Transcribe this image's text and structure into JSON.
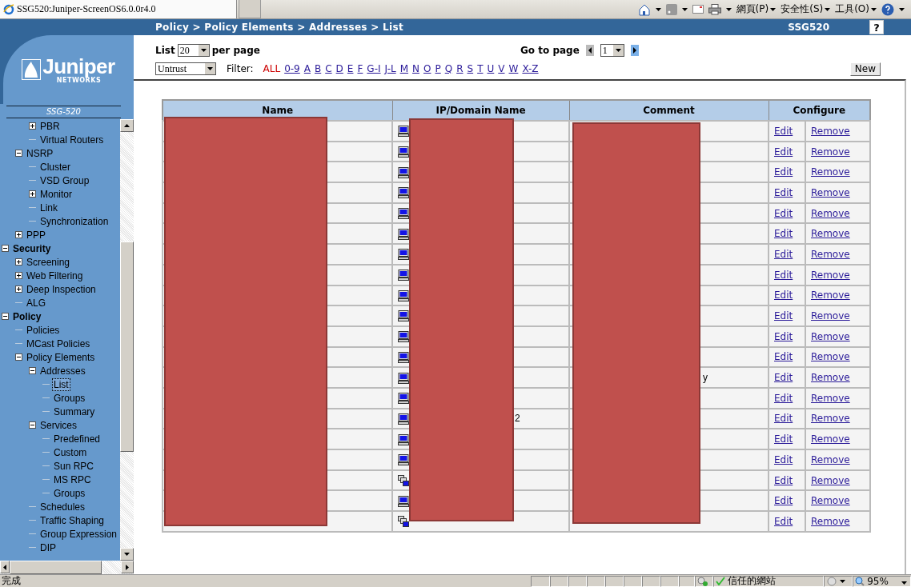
{
  "browser": {
    "tab_title": "SSG520:Juniper-ScreenOS6.0.0r4.0",
    "menus": [
      "網頁(P)",
      "安全性(S)",
      "工具(O)"
    ]
  },
  "header": {
    "breadcrumb": "Policy > Policy Elements > Addresses > List",
    "device": "SSG520",
    "help": "?"
  },
  "sidebar": {
    "logo": "Juniper",
    "logo_sub": "NETWORKS",
    "model": "SSG-520",
    "tree": [
      {
        "children": [
          {
            "children": [
              {
                "label": "PBR",
                "expanded": false,
                "selected": false
              },
              {
                "label": "Virtual Routers",
                "selected": false
              }
            ]
          },
          {
            "label": "NSRP",
            "expanded": true,
            "selected": false,
            "children": [
              {
                "label": "Cluster",
                "selected": false
              },
              {
                "label": "VSD Group",
                "selected": false
              },
              {
                "label": "Monitor",
                "expanded": false,
                "selected": false
              },
              {
                "label": "Link",
                "selected": false
              },
              {
                "label": "Synchronization",
                "selected": false
              }
            ]
          },
          {
            "label": "PPP",
            "expanded": false,
            "selected": false
          }
        ]
      },
      {
        "label": "Security",
        "expanded": true,
        "selected": false,
        "children": [
          {
            "label": "Screening",
            "expanded": false,
            "selected": false
          },
          {
            "label": "Web Filtering",
            "expanded": false,
            "selected": false
          },
          {
            "label": "Deep Inspection",
            "expanded": false,
            "selected": false
          },
          {
            "label": "ALG",
            "selected": false
          }
        ]
      },
      {
        "label": "Policy",
        "expanded": true,
        "selected": false,
        "children": [
          {
            "label": "Policies",
            "selected": false
          },
          {
            "label": "MCast Policies",
            "selected": false
          },
          {
            "label": "Policy Elements",
            "expanded": true,
            "selected": false,
            "children": [
              {
                "label": "Addresses",
                "expanded": true,
                "selected": false,
                "children": [
                  {
                    "label": "List",
                    "selected": true
                  },
                  {
                    "label": "Groups",
                    "selected": false
                  },
                  {
                    "label": "Summary",
                    "selected": false
                  }
                ]
              },
              {
                "label": "Services",
                "expanded": true,
                "selected": false,
                "children": [
                  {
                    "label": "Predefined",
                    "selected": false
                  },
                  {
                    "label": "Custom",
                    "selected": false
                  },
                  {
                    "label": "Sun RPC",
                    "selected": false
                  },
                  {
                    "label": "MS RPC",
                    "selected": false
                  },
                  {
                    "label": "Groups",
                    "selected": false
                  }
                ]
              },
              {
                "label": "Schedules",
                "selected": false
              },
              {
                "label": "Traffic Shaping",
                "selected": false
              },
              {
                "label": "Group Expression",
                "selected": false
              },
              {
                "label": "DIP",
                "selected": false
              }
            ]
          }
        ]
      }
    ]
  },
  "list_controls": {
    "label": "List",
    "per_page": "20",
    "suffix": "per page",
    "goto_label": "Go to page",
    "page": "1"
  },
  "filter": {
    "zone": "Untrust",
    "label": "Filter:",
    "letters": [
      {
        "label": "ALL",
        "selected": true
      },
      {
        "label": "0-9",
        "selected": false
      },
      {
        "label": "A",
        "selected": false
      },
      {
        "label": "B",
        "selected": false
      },
      {
        "label": "C",
        "selected": false
      },
      {
        "label": "D",
        "selected": false
      },
      {
        "label": "E",
        "selected": false
      },
      {
        "label": "F",
        "selected": false
      },
      {
        "label": "G-I",
        "selected": false
      },
      {
        "label": "J-L",
        "selected": false
      },
      {
        "label": "M",
        "selected": false
      },
      {
        "label": "N",
        "selected": false
      },
      {
        "label": "O",
        "selected": false
      },
      {
        "label": "P",
        "selected": false
      },
      {
        "label": "Q",
        "selected": false
      },
      {
        "label": "R",
        "selected": false
      },
      {
        "label": "S",
        "selected": false
      },
      {
        "label": "T",
        "selected": false
      },
      {
        "label": "U",
        "selected": false
      },
      {
        "label": "V",
        "selected": false
      },
      {
        "label": "W",
        "selected": false
      },
      {
        "label": "X-Z",
        "selected": false
      }
    ],
    "new_button": "New"
  },
  "table": {
    "columns": [
      "Name",
      "IP/Domain Name",
      "Comment",
      "Configure"
    ],
    "rows": [
      {
        "kind": "host",
        "edit": "Edit",
        "remove": "Remove"
      },
      {
        "kind": "host",
        "edit": "Edit",
        "remove": "Remove"
      },
      {
        "kind": "host",
        "edit": "Edit",
        "remove": "Remove"
      },
      {
        "kind": "host",
        "edit": "Edit",
        "remove": "Remove"
      },
      {
        "kind": "host",
        "edit": "Edit",
        "remove": "Remove"
      },
      {
        "kind": "host",
        "edit": "Edit",
        "remove": "Remove"
      },
      {
        "kind": "host",
        "edit": "Edit",
        "remove": "Remove"
      },
      {
        "kind": "host",
        "edit": "Edit",
        "remove": "Remove"
      },
      {
        "kind": "host",
        "edit": "Edit",
        "remove": "Remove"
      },
      {
        "kind": "host",
        "edit": "Edit",
        "remove": "Remove"
      },
      {
        "kind": "host",
        "edit": "Edit",
        "remove": "Remove"
      },
      {
        "kind": "host",
        "edit": "Edit",
        "remove": "Remove"
      },
      {
        "kind": "host",
        "comment": "y",
        "edit": "Edit",
        "remove": "Remove"
      },
      {
        "kind": "host",
        "edit": "Edit",
        "remove": "Remove"
      },
      {
        "kind": "host",
        "ip": "2",
        "edit": "Edit",
        "remove": "Remove"
      },
      {
        "kind": "host",
        "edit": "Edit",
        "remove": "Remove"
      },
      {
        "kind": "host",
        "edit": "Edit",
        "remove": "Remove"
      },
      {
        "kind": "group",
        "edit": "Edit",
        "remove": "Remove"
      },
      {
        "kind": "host",
        "edit": "Edit",
        "remove": "Remove"
      },
      {
        "kind": "group",
        "edit": "Edit",
        "remove": "Remove"
      }
    ]
  },
  "status_bar": {
    "text": "完成",
    "zone": "信任的網站",
    "zoom": "95%"
  }
}
